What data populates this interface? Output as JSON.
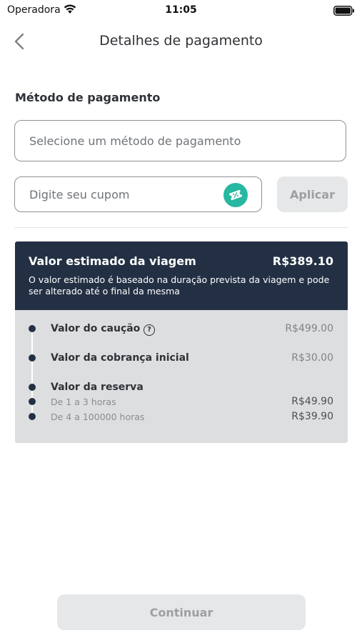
{
  "status_bar": {
    "carrier": "Operadora",
    "time": "11:05"
  },
  "nav": {
    "title": "Detalhes de pagamento"
  },
  "payment": {
    "section_label": "Método de pagamento",
    "method_placeholder": "Selecione um método de pagamento",
    "coupon_placeholder": "Digite seu cupom",
    "apply_label": "Aplicar"
  },
  "estimate": {
    "title": "Valor estimado da viagem",
    "amount": "R$389.10",
    "description": "O valor estimado é baseado na duração prevista da viagem e pode ser alterado até o final da mesma",
    "items": [
      {
        "label": "Valor do caução",
        "value": "R$499.00"
      },
      {
        "label": "Valor da cobrança inicial",
        "value": "R$30.00"
      },
      {
        "label": "Valor da reserva"
      }
    ],
    "reservation_tiers": [
      {
        "label": "De 1 a 3 horas",
        "value": "R$49.90"
      },
      {
        "label": "De 4 a 100000 horas",
        "value": "R$39.90"
      }
    ]
  },
  "footer": {
    "continue_label": "Continuar"
  },
  "colors": {
    "card_header": "#233044",
    "card_body": "#dcdee0",
    "coupon_badge": "#26b8a0",
    "disabled_button": "#e6e7e8"
  },
  "icons": [
    "wifi-icon",
    "battery-icon",
    "back-arrow-icon",
    "coupon-percent-icon",
    "help-icon"
  ]
}
